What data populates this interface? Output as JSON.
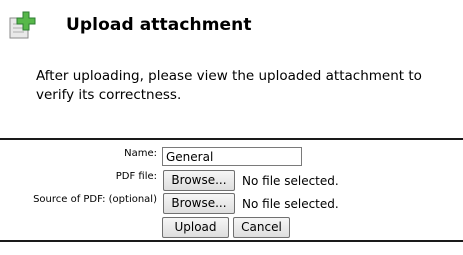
{
  "header": {
    "icon": "add-attachment-icon",
    "title": "Upload attachment"
  },
  "instructions": "After uploading, please view the uploaded attachment to verify its correctness.",
  "form": {
    "name_label": "Name:",
    "name_value": "General",
    "pdf_label": "PDF file:",
    "source_label": "Source of PDF: (optional)",
    "browse_label": "Browse...",
    "no_file_text": "No file selected.",
    "upload_label": "Upload",
    "cancel_label": "Cancel"
  },
  "colors": {
    "icon_green": "#4caf50",
    "rule": "#1a1a1a"
  }
}
